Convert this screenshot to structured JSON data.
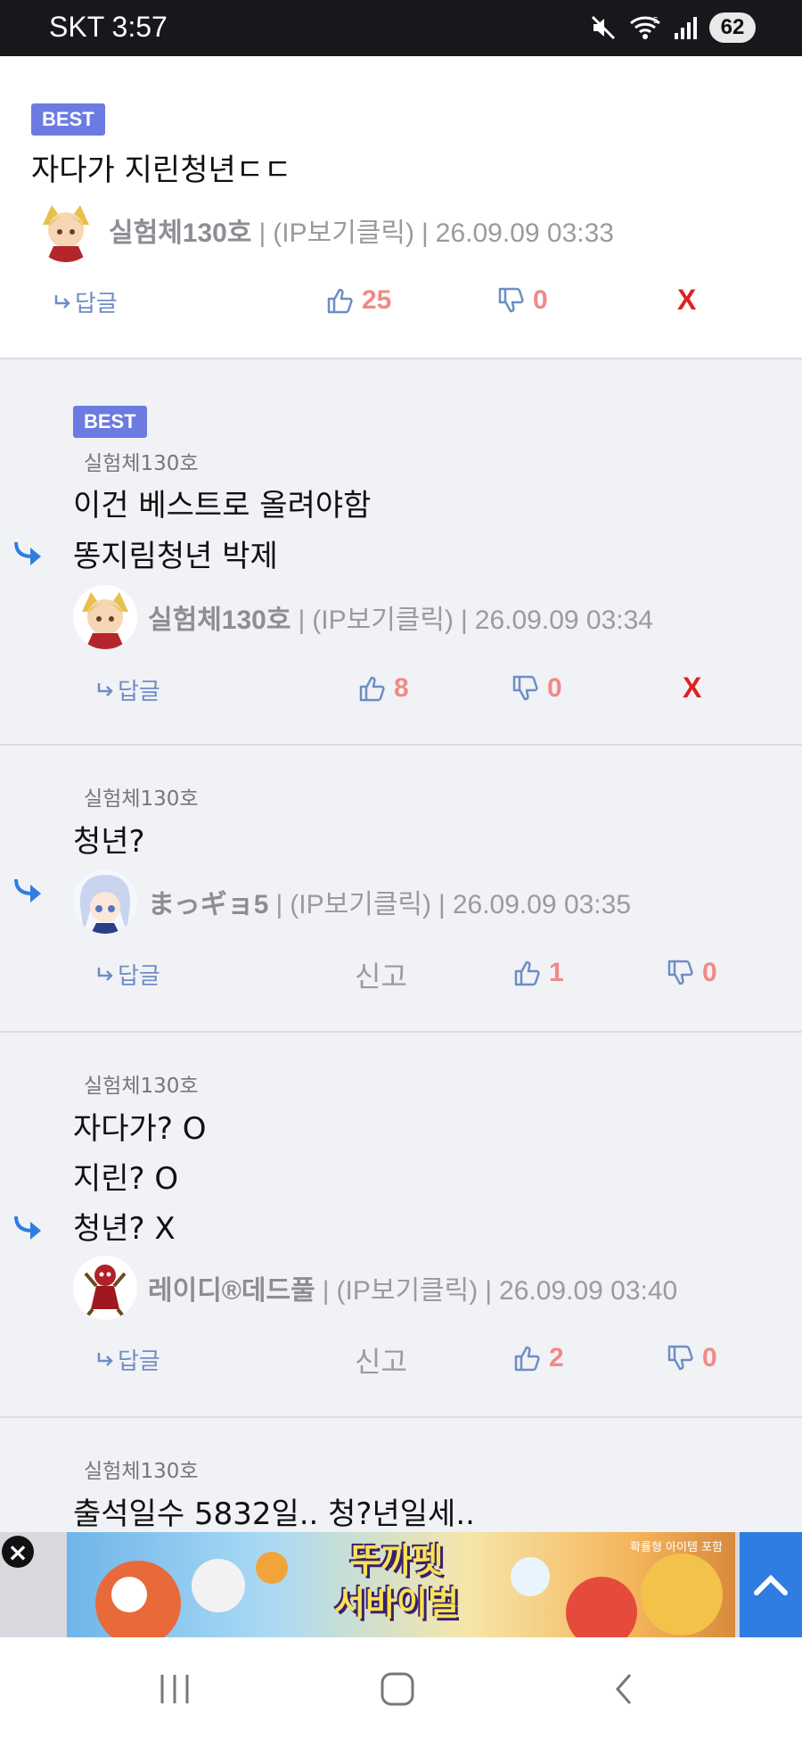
{
  "status_bar": {
    "carrier": "SKT",
    "time": "3:57",
    "battery": "62",
    "network_badge": "5"
  },
  "comments": [
    {
      "best_label": "BEST",
      "body": [
        "자다가 지린청년ㄷㄷ"
      ],
      "author": "실험체130호",
      "ip_label": "(IP보기클릭)",
      "datetime": "26.09.09 03:33",
      "reply_label": "답글",
      "likes": "25",
      "dislikes": "0",
      "x_label": "X"
    },
    {
      "best_label": "BEST",
      "parent": "실험체130호",
      "body": [
        "이건 베스트로 올려야함",
        "똥지림청년 박제"
      ],
      "author": "실험체130호",
      "ip_label": "(IP보기클릭)",
      "datetime": "26.09.09 03:34",
      "reply_label": "답글",
      "likes": "8",
      "dislikes": "0",
      "x_label": "X"
    },
    {
      "parent": "실험체130호",
      "body": [
        "청년?"
      ],
      "author": "まっギョ5",
      "ip_label": "(IP보기클릭)",
      "datetime": "26.09.09 03:35",
      "reply_label": "답글",
      "report_label": "신고",
      "likes": "1",
      "dislikes": "0"
    },
    {
      "parent": "실험체130호",
      "body": [
        "자다가? O",
        "지린? O",
        "청년? X"
      ],
      "author": "레이디®데드풀",
      "ip_label": "(IP보기클릭)",
      "datetime": "26.09.09 03:40",
      "reply_label": "답글",
      "report_label": "신고",
      "likes": "2",
      "dislikes": "0"
    },
    {
      "parent": "실험체130호",
      "body": [
        "출석일수 5832일.. 청?년일세.."
      ]
    }
  ],
  "ad": {
    "title_line1": "뚜까펫",
    "title_line2": "서바이벌",
    "note": "확률형 아이템 포함"
  },
  "colors": {
    "best_badge": "#6b7be0",
    "reply_bg": "#f1f2f6",
    "vote_count": "#f08a86",
    "x": "#e02020",
    "accent_blue": "#2f7de0"
  },
  "icons": [
    "mute-icon",
    "wifi-icon",
    "signal-icon",
    "reply-arrow-icon",
    "thumbs-up-icon",
    "thumbs-down-icon",
    "close-icon",
    "chevron-up-icon",
    "recents-icon",
    "home-icon",
    "back-icon"
  ]
}
